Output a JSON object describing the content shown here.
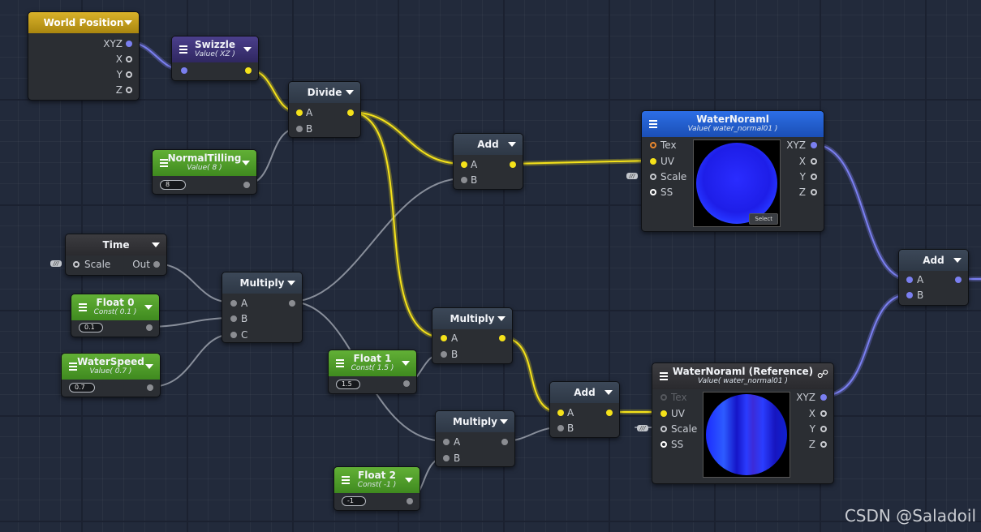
{
  "colors": {
    "yellow_wire": "#f5e21a",
    "blue_wire": "#7a7ff0",
    "gray_wire": "#9aa0ab"
  },
  "nodes": {
    "world_position": {
      "title": "World Position",
      "outputs": [
        "XYZ",
        "X",
        "Y",
        "Z"
      ]
    },
    "swizzle": {
      "title": "Swizzle",
      "subtitle": "Value( XZ )"
    },
    "divide": {
      "title": "Divide",
      "inputs": [
        "A",
        "B"
      ]
    },
    "normal_tiling": {
      "title": "NormalTilling",
      "subtitle": "Value( 8 )",
      "value": "8"
    },
    "add_top": {
      "title": "Add",
      "inputs": [
        "A",
        "B"
      ]
    },
    "water_normal": {
      "title": "WaterNoraml",
      "subtitle": "Value( water_normal01 )",
      "inputs": [
        "Tex",
        "UV",
        "Scale",
        "SS"
      ],
      "outputs": [
        "XYZ",
        "X",
        "Y",
        "Z"
      ],
      "select": "Select"
    },
    "time": {
      "title": "Time",
      "input": "Scale",
      "output": "Out"
    },
    "float0": {
      "title": "Float 0",
      "subtitle": "Const( 0.1 )",
      "value": "0.1"
    },
    "water_speed": {
      "title": "WaterSpeed",
      "subtitle": "Value( 0.7 )",
      "value": "0.7"
    },
    "multiply_left": {
      "title": "Multiply",
      "inputs": [
        "A",
        "B",
        "C"
      ]
    },
    "float1": {
      "title": "Float 1",
      "subtitle": "Const( 1.5 )",
      "value": "1.5"
    },
    "multiply_mid": {
      "title": "Multiply",
      "inputs": [
        "A",
        "B"
      ]
    },
    "multiply_low": {
      "title": "Multiply",
      "inputs": [
        "A",
        "B"
      ]
    },
    "float2": {
      "title": "Float 2",
      "subtitle": "Const( -1 )",
      "value": "-1"
    },
    "add_mid": {
      "title": "Add",
      "inputs": [
        "A",
        "B"
      ]
    },
    "water_normal_ref": {
      "title": "WaterNoraml (Reference)",
      "subtitle": "Value( water_normal01 )",
      "inputs": [
        "Tex",
        "UV",
        "Scale",
        "SS"
      ],
      "outputs": [
        "XYZ",
        "X",
        "Y",
        "Z"
      ]
    },
    "add_right": {
      "title": "Add",
      "inputs": [
        "A",
        "B"
      ]
    }
  },
  "watermark": "CSDN @Saladoil"
}
